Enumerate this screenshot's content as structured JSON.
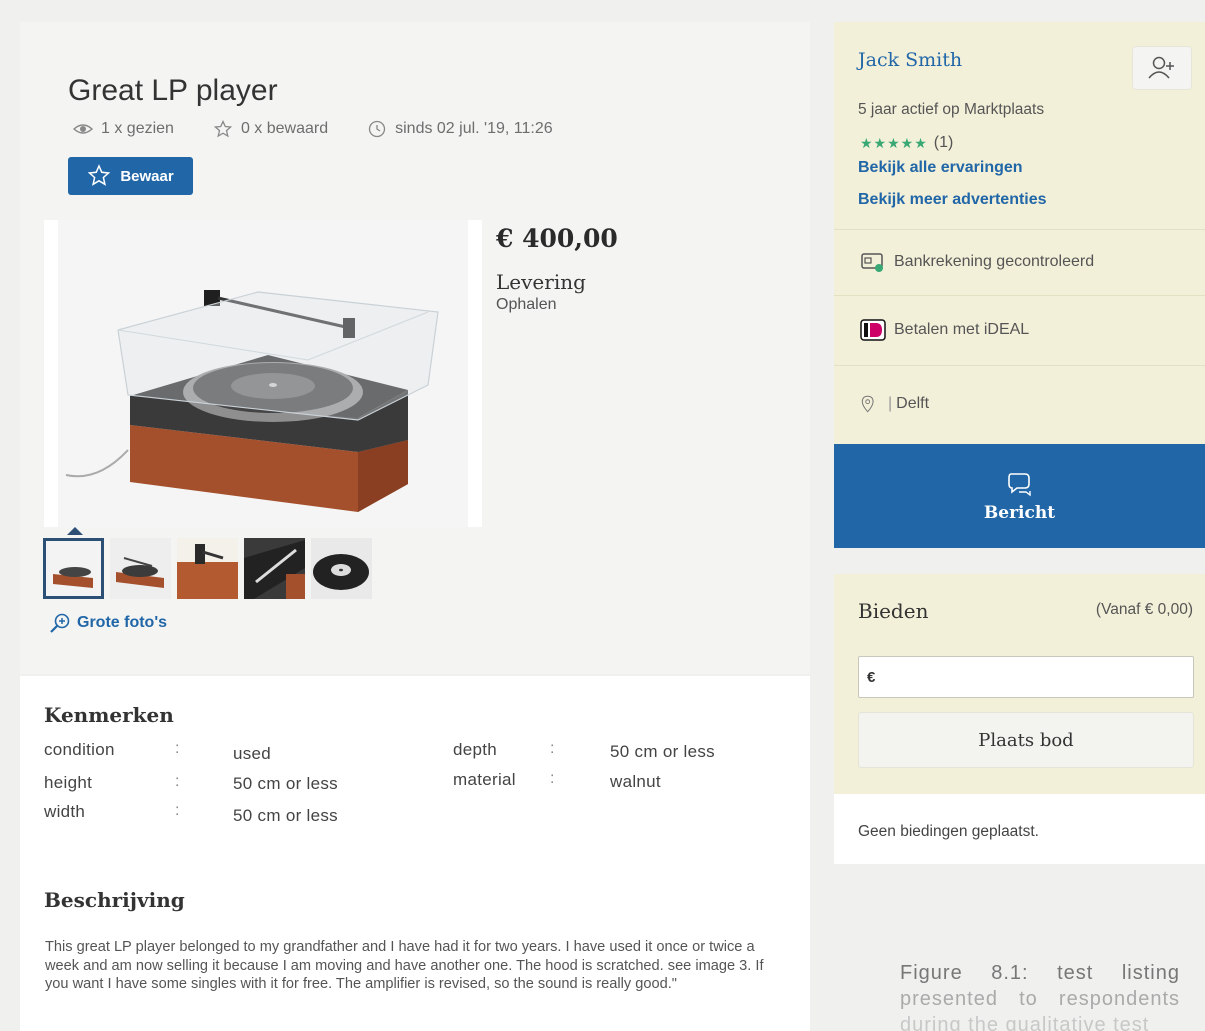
{
  "listing": {
    "title": "Great LP player",
    "views": "1 x gezien",
    "saves": "0 x bewaard",
    "since": "sinds 02 jul. '19, 11:26",
    "save_button": "Bewaar",
    "price": "€ 400,00",
    "delivery_label": "Levering",
    "delivery_value": "Ophalen",
    "large_photos_link": "Grote foto's",
    "thumbnail_count": 5,
    "active_thumbnail": 1
  },
  "features": {
    "title": "Kenmerken",
    "separator": ":",
    "left": [
      {
        "label": "condition",
        "value": "used"
      },
      {
        "label": "height",
        "value": "50 cm or less"
      },
      {
        "label": "width",
        "value": "50 cm or less"
      }
    ],
    "right": [
      {
        "label": "depth",
        "value": "50 cm or less"
      },
      {
        "label": "material",
        "value": "walnut"
      }
    ]
  },
  "description": {
    "title": "Beschrijving",
    "text": "This great LP player belonged to my grandfather and I have had it for two years. I have used it once or twice a week and am now selling it because I am moving and have another one. The hood is scratched. see image 3. If you want I have some singles with it for free. The amplifier is revised, so the sound is really good.\""
  },
  "seller": {
    "name": "Jack Smith",
    "active_since": "5 jaar actief op Marktplaats",
    "stars": "★★★★★",
    "review_count": "(1)",
    "link_reviews": "Bekijk alle ervaringen",
    "link_more_ads": "Bekijk meer advertenties",
    "bank_verified": "Bankrekening gecontroleerd",
    "ideal": "Betalen met iDEAL",
    "location": "Delft",
    "message_button": "Bericht"
  },
  "bid": {
    "title": "Bieden",
    "from": "(Vanaf € 0,00)",
    "currency": "€",
    "input_value": "",
    "place_button": "Plaats bod",
    "no_bids": "Geen biedingen geplaatst."
  },
  "caption": {
    "line1": "Figure 8.1: test listing",
    "line2": "presented to respondents",
    "line3": "during the qualitative test"
  },
  "colors": {
    "primary_blue": "#2167a8",
    "seller_bg": "#f3f0d9",
    "star_green": "#39a874"
  }
}
